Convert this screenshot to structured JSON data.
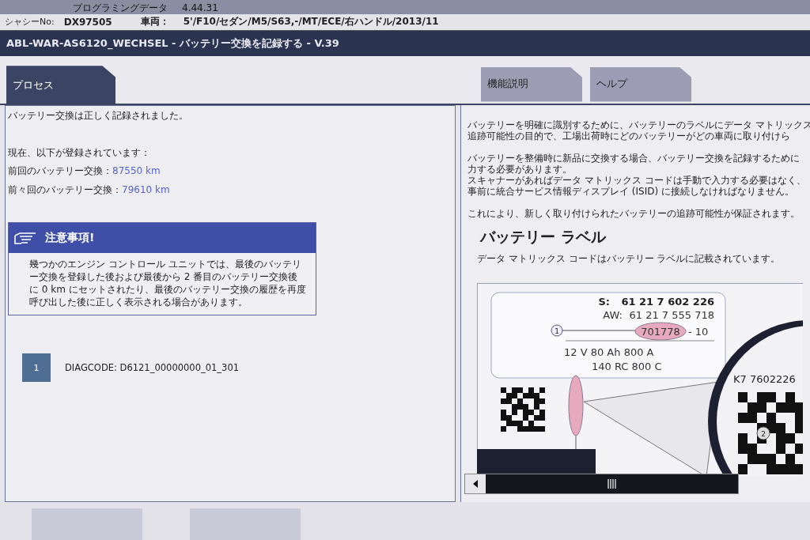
{
  "header": {
    "program_label": "プログラミングデータ",
    "program_version": "4.44.31"
  },
  "vehicle": {
    "chassis_label": "シャシーNo:",
    "chassis_no": "DX97505",
    "vehicle_label": "車両：",
    "vehicle": "5'/F10/セダン/M5/S63,-/MT/ECE/右ハンドル/2013/11"
  },
  "title": "ABL-WAR-AS6120_WECHSEL - バッテリー交換を記録する - V.39",
  "tabs_left": [
    {
      "label": "プロセス",
      "selected": true
    }
  ],
  "tabs_right": [
    {
      "label": "機能説明",
      "selected": false
    },
    {
      "label": "ヘルプ",
      "selected": false
    }
  ],
  "process": {
    "message": "バッテリー交換は正しく記録されました。",
    "registered_heading": "現在、以下が登録されています：",
    "entries": [
      {
        "label": "前回のバッテリー交換：",
        "value": "87550 km"
      },
      {
        "label": "前々回のバッテリー交換：",
        "value": "79610 km"
      }
    ],
    "notice": {
      "title": "注意事項!",
      "text": "幾つかのエンジン コントロール ユニットでは、最後のバッテリー交換を登録した後および最後から 2 番目のバッテリー交換後に 0 km にセットされたり、最後のバッテリー交換の履歴を再度呼び出した後に正しく表示される場合があります。"
    },
    "steps": [
      {
        "number": "1",
        "text": "DIAGCODE: D6121_00000000_01_301"
      }
    ]
  },
  "help": {
    "paragraphs": [
      [
        "バッテリーを明確に識別するために、バッテリーのラベルにデータ マトリックス",
        "追跡可能性の目的で、工場出荷時にどのバッテリーがどの車両に取り付けら"
      ],
      [
        "バッテリーを整備時に新品に交換する場合、バッテリー交換を記録するために",
        "力する必要があります。",
        "スキャナーがあればデータ マトリックス コードは手動で入力する必要はなく、",
        "事前に統合サービス情報ディスプレイ (ISID) に接続しなければなりません。"
      ],
      [
        "これにより、新しく取り付けられたバッテリーの追跡可能性が保証されます。"
      ]
    ],
    "heading": "バッテリー ラベル",
    "caption": "データ マトリックス コードはバッテリー ラベルに記載されています。",
    "label": {
      "s_label": "S:",
      "s_value": "61 21 7 602 226",
      "aw_label": "AW:",
      "aw_value": "61 21 7 555 718",
      "marked": "701778",
      "marked_suffix": "- 10",
      "ratings": "12 V  80 Ah   800 A",
      "ratings2": "140 RC 800 C",
      "callout_1": "1",
      "callout_2": "2",
      "zoom_code": "K7 7602226"
    }
  }
}
